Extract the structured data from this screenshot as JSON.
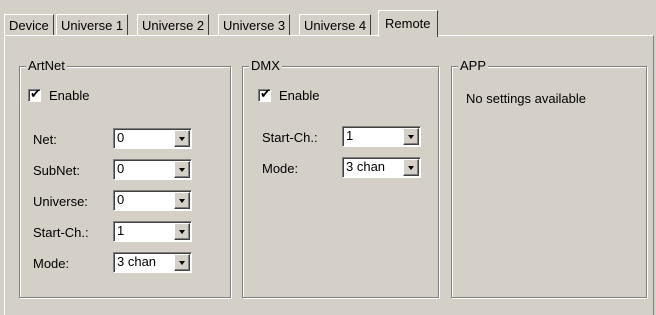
{
  "tabs": [
    {
      "label": "Device",
      "active": false
    },
    {
      "label": "Universe 1",
      "active": false
    },
    {
      "label": "Universe 2",
      "active": false
    },
    {
      "label": "Universe 3",
      "active": false
    },
    {
      "label": "Universe 4",
      "active": false
    },
    {
      "label": "Remote",
      "active": true
    }
  ],
  "artnet": {
    "title": "ArtNet",
    "enable_label": "Enable",
    "enable_checked": true,
    "fields": [
      {
        "label": "Net:",
        "value": "0"
      },
      {
        "label": "SubNet:",
        "value": "0"
      },
      {
        "label": "Universe:",
        "value": "0"
      },
      {
        "label": "Start-Ch.:",
        "value": "1"
      },
      {
        "label": "Mode:",
        "value": "3 chan"
      }
    ]
  },
  "dmx": {
    "title": "DMX",
    "enable_label": "Enable",
    "enable_checked": true,
    "fields": [
      {
        "label": "Start-Ch.:",
        "value": "1"
      },
      {
        "label": "Mode:",
        "value": "3 chan"
      }
    ]
  },
  "app": {
    "title": "APP",
    "message": "No settings available"
  },
  "colors": {
    "face": "#d4d0c8",
    "highlight": "#ffffff",
    "shadow": "#808080",
    "dark_shadow": "#404040"
  }
}
